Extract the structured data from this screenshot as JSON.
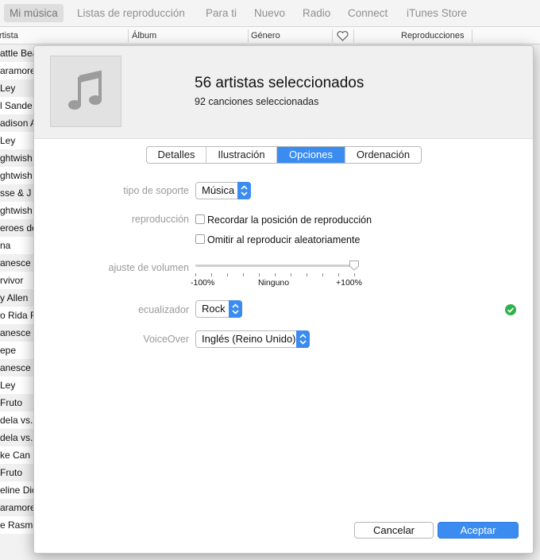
{
  "nav": {
    "items": [
      {
        "label": "Mi música"
      },
      {
        "label": "Listas de reproducción"
      },
      {
        "label": "Para ti"
      },
      {
        "label": "Nuevo"
      },
      {
        "label": "Radio"
      },
      {
        "label": "Connect"
      },
      {
        "label": "iTunes Store"
      }
    ],
    "active_index": 0
  },
  "columns": {
    "artist": "rtista",
    "album": "Álbum",
    "genre": "Género",
    "love_icon": "heart-icon",
    "plays": "Reproducciones"
  },
  "artists": [
    "attle Bea",
    "aramore",
    "Ley",
    "l Sande",
    "adison A",
    "Ley",
    "ghtwish",
    "ghtwish",
    "sse & J",
    "ghtwish",
    "eroes de",
    "na",
    "anesce",
    "rvivor",
    "y Allen",
    "o Rida F",
    "anesce",
    "epe",
    "anesce",
    "Ley",
    "Fruto",
    "dela vs.",
    "dela vs.",
    "ke Can",
    "Fruto",
    "eline Dic",
    "aramore",
    "e Rasm"
  ],
  "dialog": {
    "artwork_icon": "music-note-icon",
    "title": "56 artistas seleccionados",
    "subtitle": "92 canciones seleccionadas",
    "tabs": [
      {
        "label": "Detalles"
      },
      {
        "label": "Ilustración"
      },
      {
        "label": "Opciones"
      },
      {
        "label": "Ordenación"
      }
    ],
    "selected_tab": 2,
    "media_kind": {
      "label": "tipo de soporte",
      "value": "Música"
    },
    "playback": {
      "label": "reproducción",
      "remember_position": {
        "label": "Recordar la posición de reproducción",
        "checked": false
      },
      "skip_shuffle": {
        "label": "Omitir al reproducir aleatoriamente",
        "checked": false
      }
    },
    "volume": {
      "label": "ajuste de volumen",
      "min_label": "-100%",
      "mid_label": "Ninguno",
      "max_label": "+100%",
      "value_fraction": 1.0
    },
    "equalizer": {
      "label": "ecualizador",
      "value": "Rock",
      "status_icon": "check-circle-icon",
      "status_color": "#2fb24c"
    },
    "voiceover": {
      "label": "VoiceOver",
      "value": "Inglés (Reino Unido)"
    },
    "buttons": {
      "cancel": "Cancelar",
      "ok": "Aceptar"
    }
  },
  "colors": {
    "accent": "#3b8cf0",
    "success": "#2fb24c"
  }
}
